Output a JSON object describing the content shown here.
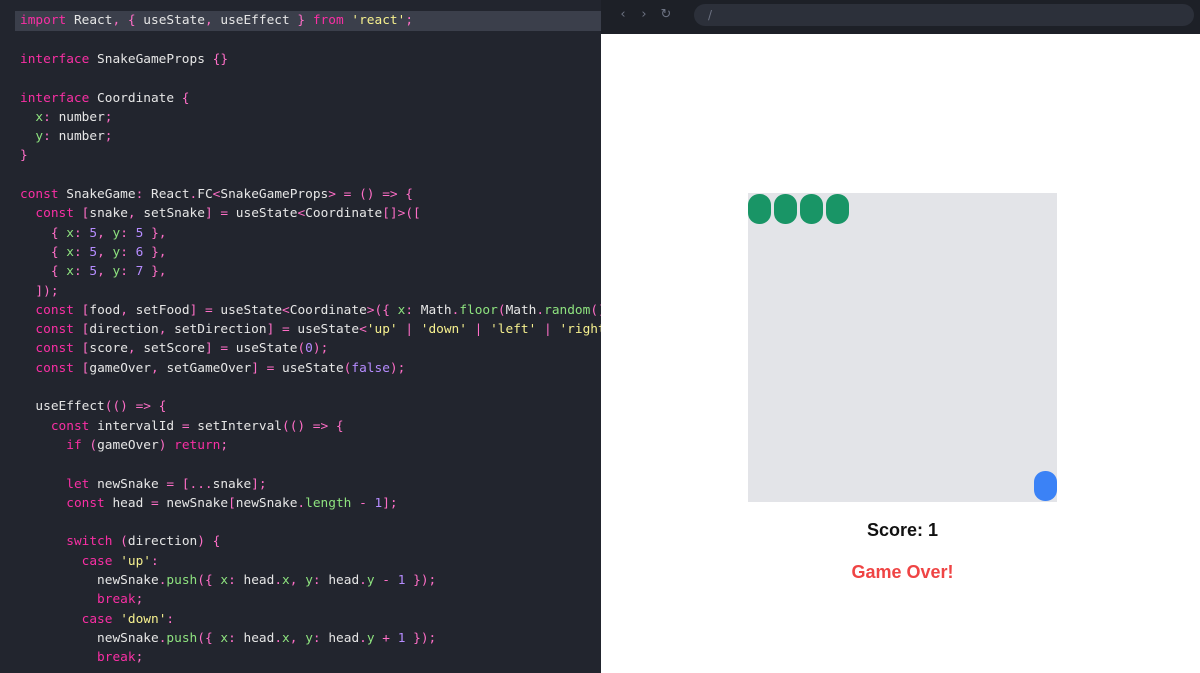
{
  "editor": {
    "lines": [
      [
        [
          "k",
          "import"
        ],
        [
          "t",
          " React"
        ],
        [
          "p",
          ", { "
        ],
        [
          "t",
          "useState"
        ],
        [
          "p",
          ", "
        ],
        [
          "t",
          "useEffect"
        ],
        [
          "p",
          " } "
        ],
        [
          "k",
          "from"
        ],
        [
          "t",
          " "
        ],
        [
          "s",
          "'react'"
        ],
        [
          "p",
          ";"
        ]
      ],
      [],
      [
        [
          "k",
          "interface"
        ],
        [
          "t",
          " SnakeGameProps "
        ],
        [
          "p",
          "{}"
        ]
      ],
      [],
      [
        [
          "k",
          "interface"
        ],
        [
          "t",
          " Coordinate "
        ],
        [
          "p",
          "{"
        ]
      ],
      [
        [
          "t",
          "  "
        ],
        [
          "pr",
          "x"
        ],
        [
          "p",
          ": "
        ],
        [
          "t",
          "number"
        ],
        [
          "p",
          ";"
        ]
      ],
      [
        [
          "t",
          "  "
        ],
        [
          "pr",
          "y"
        ],
        [
          "p",
          ": "
        ],
        [
          "t",
          "number"
        ],
        [
          "p",
          ";"
        ]
      ],
      [
        [
          "p",
          "}"
        ]
      ],
      [],
      [
        [
          "k",
          "const"
        ],
        [
          "t",
          " SnakeGame"
        ],
        [
          "p",
          ": "
        ],
        [
          "t",
          "React"
        ],
        [
          "p",
          "."
        ],
        [
          "t",
          "FC"
        ],
        [
          "p",
          "<"
        ],
        [
          "t",
          "SnakeGameProps"
        ],
        [
          "p",
          "> = () => {"
        ]
      ],
      [
        [
          "t",
          "  "
        ],
        [
          "k",
          "const"
        ],
        [
          "p",
          " ["
        ],
        [
          "t",
          "snake"
        ],
        [
          "p",
          ", "
        ],
        [
          "t",
          "setSnake"
        ],
        [
          "p",
          "] = "
        ],
        [
          "t",
          "useState"
        ],
        [
          "p",
          "<"
        ],
        [
          "t",
          "Coordinate"
        ],
        [
          "p",
          "[]>(["
        ]
      ],
      [
        [
          "t",
          "    "
        ],
        [
          "p",
          "{ "
        ],
        [
          "pr",
          "x"
        ],
        [
          "p",
          ": "
        ],
        [
          "n",
          "5"
        ],
        [
          "p",
          ", "
        ],
        [
          "pr",
          "y"
        ],
        [
          "p",
          ": "
        ],
        [
          "n",
          "5"
        ],
        [
          "p",
          " },"
        ]
      ],
      [
        [
          "t",
          "    "
        ],
        [
          "p",
          "{ "
        ],
        [
          "pr",
          "x"
        ],
        [
          "p",
          ": "
        ],
        [
          "n",
          "5"
        ],
        [
          "p",
          ", "
        ],
        [
          "pr",
          "y"
        ],
        [
          "p",
          ": "
        ],
        [
          "n",
          "6"
        ],
        [
          "p",
          " },"
        ]
      ],
      [
        [
          "t",
          "    "
        ],
        [
          "p",
          "{ "
        ],
        [
          "pr",
          "x"
        ],
        [
          "p",
          ": "
        ],
        [
          "n",
          "5"
        ],
        [
          "p",
          ", "
        ],
        [
          "pr",
          "y"
        ],
        [
          "p",
          ": "
        ],
        [
          "n",
          "7"
        ],
        [
          "p",
          " },"
        ]
      ],
      [
        [
          "t",
          "  "
        ],
        [
          "p",
          "]);"
        ]
      ],
      [
        [
          "t",
          "  "
        ],
        [
          "k",
          "const"
        ],
        [
          "p",
          " ["
        ],
        [
          "t",
          "food"
        ],
        [
          "p",
          ", "
        ],
        [
          "t",
          "setFood"
        ],
        [
          "p",
          "] = "
        ],
        [
          "t",
          "useState"
        ],
        [
          "p",
          "<"
        ],
        [
          "t",
          "Coordinate"
        ],
        [
          "p",
          ">({ "
        ],
        [
          "pr",
          "x"
        ],
        [
          "p",
          ": "
        ],
        [
          "t",
          "Math"
        ],
        [
          "p",
          "."
        ],
        [
          "pr",
          "floor"
        ],
        [
          "p",
          "("
        ],
        [
          "t",
          "Math"
        ],
        [
          "p",
          "."
        ],
        [
          "pr",
          "random"
        ],
        [
          "p",
          "()"
        ]
      ],
      [
        [
          "t",
          "  "
        ],
        [
          "k",
          "const"
        ],
        [
          "p",
          " ["
        ],
        [
          "t",
          "direction"
        ],
        [
          "p",
          ", "
        ],
        [
          "t",
          "setDirection"
        ],
        [
          "p",
          "] = "
        ],
        [
          "t",
          "useState"
        ],
        [
          "p",
          "<"
        ],
        [
          "s",
          "'up'"
        ],
        [
          "p",
          " | "
        ],
        [
          "s",
          "'down'"
        ],
        [
          "p",
          " | "
        ],
        [
          "s",
          "'left'"
        ],
        [
          "p",
          " | "
        ],
        [
          "s",
          "'right'"
        ]
      ],
      [
        [
          "t",
          "  "
        ],
        [
          "k",
          "const"
        ],
        [
          "p",
          " ["
        ],
        [
          "t",
          "score"
        ],
        [
          "p",
          ", "
        ],
        [
          "t",
          "setScore"
        ],
        [
          "p",
          "] = "
        ],
        [
          "t",
          "useState"
        ],
        [
          "p",
          "("
        ],
        [
          "n",
          "0"
        ],
        [
          "p",
          ");"
        ]
      ],
      [
        [
          "t",
          "  "
        ],
        [
          "k",
          "const"
        ],
        [
          "p",
          " ["
        ],
        [
          "t",
          "gameOver"
        ],
        [
          "p",
          ", "
        ],
        [
          "t",
          "setGameOver"
        ],
        [
          "p",
          "] = "
        ],
        [
          "t",
          "useState"
        ],
        [
          "p",
          "("
        ],
        [
          "n",
          "false"
        ],
        [
          "p",
          ");"
        ]
      ],
      [],
      [
        [
          "t",
          "  useEffect"
        ],
        [
          "p",
          "(() => {"
        ]
      ],
      [
        [
          "t",
          "    "
        ],
        [
          "k",
          "const"
        ],
        [
          "t",
          " intervalId "
        ],
        [
          "p",
          "= "
        ],
        [
          "t",
          "setInterval"
        ],
        [
          "p",
          "(() => {"
        ]
      ],
      [
        [
          "t",
          "      "
        ],
        [
          "k",
          "if"
        ],
        [
          "p",
          " ("
        ],
        [
          "t",
          "gameOver"
        ],
        [
          "p",
          ") "
        ],
        [
          "k",
          "return"
        ],
        [
          "p",
          ";"
        ]
      ],
      [],
      [
        [
          "t",
          "      "
        ],
        [
          "k",
          "let"
        ],
        [
          "t",
          " newSnake "
        ],
        [
          "p",
          "= [..."
        ],
        [
          "t",
          "snake"
        ],
        [
          "p",
          "];"
        ]
      ],
      [
        [
          "t",
          "      "
        ],
        [
          "k",
          "const"
        ],
        [
          "t",
          " head "
        ],
        [
          "p",
          "= "
        ],
        [
          "t",
          "newSnake"
        ],
        [
          "p",
          "["
        ],
        [
          "t",
          "newSnake"
        ],
        [
          "p",
          "."
        ],
        [
          "pr",
          "length"
        ],
        [
          "p",
          " - "
        ],
        [
          "n",
          "1"
        ],
        [
          "p",
          "];"
        ]
      ],
      [],
      [
        [
          "t",
          "      "
        ],
        [
          "k",
          "switch"
        ],
        [
          "p",
          " ("
        ],
        [
          "t",
          "direction"
        ],
        [
          "p",
          ") {"
        ]
      ],
      [
        [
          "t",
          "        "
        ],
        [
          "k",
          "case"
        ],
        [
          "t",
          " "
        ],
        [
          "s",
          "'up'"
        ],
        [
          "p",
          ":"
        ]
      ],
      [
        [
          "t",
          "          newSnake"
        ],
        [
          "p",
          "."
        ],
        [
          "pr",
          "push"
        ],
        [
          "p",
          "({ "
        ],
        [
          "pr",
          "x"
        ],
        [
          "p",
          ": "
        ],
        [
          "t",
          "head"
        ],
        [
          "p",
          "."
        ],
        [
          "pr",
          "x"
        ],
        [
          "p",
          ", "
        ],
        [
          "pr",
          "y"
        ],
        [
          "p",
          ": "
        ],
        [
          "t",
          "head"
        ],
        [
          "p",
          "."
        ],
        [
          "pr",
          "y"
        ],
        [
          "p",
          " - "
        ],
        [
          "n",
          "1"
        ],
        [
          "p",
          " });"
        ]
      ],
      [
        [
          "t",
          "          "
        ],
        [
          "k",
          "break"
        ],
        [
          "p",
          ";"
        ]
      ],
      [
        [
          "t",
          "        "
        ],
        [
          "k",
          "case"
        ],
        [
          "t",
          " "
        ],
        [
          "s",
          "'down'"
        ],
        [
          "p",
          ":"
        ]
      ],
      [
        [
          "t",
          "          newSnake"
        ],
        [
          "p",
          "."
        ],
        [
          "pr",
          "push"
        ],
        [
          "p",
          "({ "
        ],
        [
          "pr",
          "x"
        ],
        [
          "p",
          ": "
        ],
        [
          "t",
          "head"
        ],
        [
          "p",
          "."
        ],
        [
          "pr",
          "x"
        ],
        [
          "p",
          ", "
        ],
        [
          "pr",
          "y"
        ],
        [
          "p",
          ": "
        ],
        [
          "t",
          "head"
        ],
        [
          "p",
          "."
        ],
        [
          "pr",
          "y"
        ],
        [
          "p",
          " + "
        ],
        [
          "n",
          "1"
        ],
        [
          "p",
          " });"
        ]
      ],
      [
        [
          "t",
          "          "
        ],
        [
          "k",
          "break"
        ],
        [
          "p",
          ";"
        ]
      ]
    ]
  },
  "browser": {
    "nav": {
      "back": "‹",
      "forward": "›",
      "reload": "↻"
    },
    "url": "/",
    "score_text": "Score: 1",
    "game_over_text": "Game Over!",
    "colors": {
      "snake": "#199566",
      "food": "#3b82f6",
      "board": "#e3e4e8",
      "game_over": "#ef4444"
    },
    "snake_segments": 4
  }
}
